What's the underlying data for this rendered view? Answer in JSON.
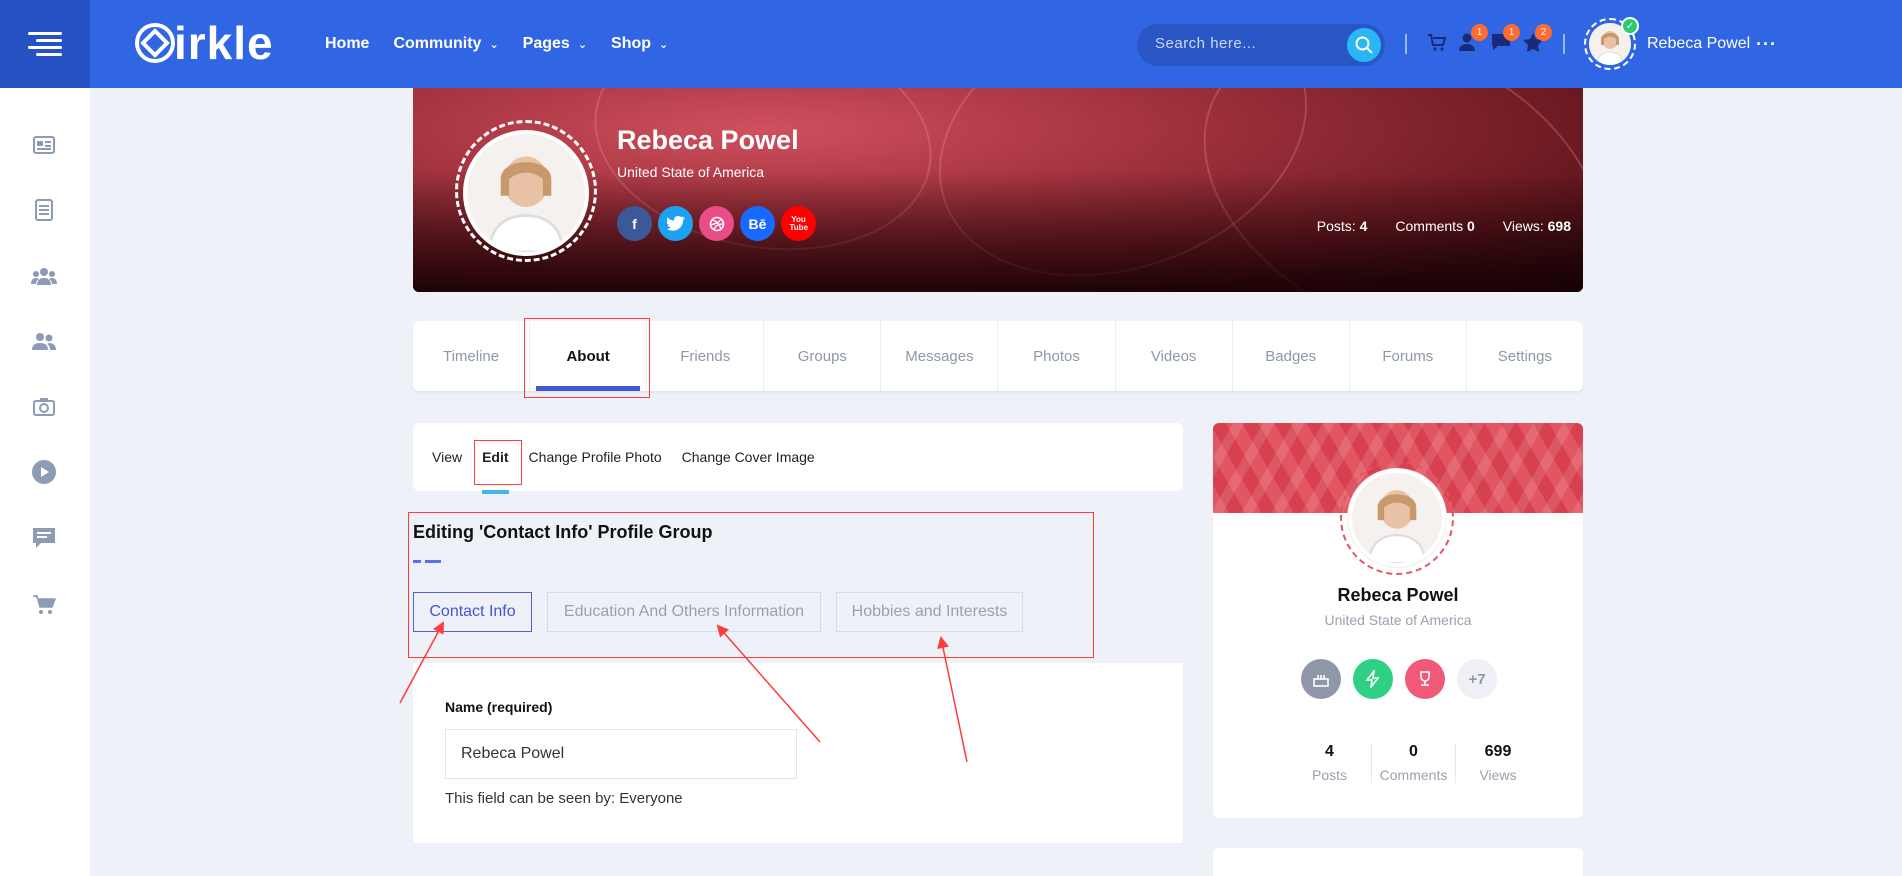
{
  "brand": {
    "logo_text": "irkle"
  },
  "header": {
    "nav": [
      {
        "label": "Home",
        "has_dropdown": false
      },
      {
        "label": "Community",
        "has_dropdown": true
      },
      {
        "label": "Pages",
        "has_dropdown": true
      },
      {
        "label": "Shop",
        "has_dropdown": true
      }
    ],
    "search_placeholder": "Search here...",
    "badges": {
      "friend_requests": "1",
      "messages": "1",
      "notifications": "2"
    },
    "user_name": "Rebeca Powel",
    "more": "···"
  },
  "sidebar": {
    "items": [
      "newsfeed-icon",
      "blog-icon",
      "groups-icon",
      "members-icon",
      "photos-icon",
      "videos-icon",
      "forums-icon",
      "shop-icon"
    ]
  },
  "profile": {
    "name": "Rebeca Powel",
    "location": "United State of America",
    "socials": [
      {
        "label": "f",
        "color": "#3b5998"
      },
      {
        "label": "t",
        "color": "#1da1f2"
      },
      {
        "label": "d",
        "color": "#ea4c89"
      },
      {
        "label": "Bē",
        "color": "#1769ff"
      },
      {
        "label": "You Tube",
        "color": "#ff0000"
      }
    ],
    "stats": {
      "posts_label": "Posts:",
      "posts": "4",
      "comments_label": "Comments",
      "comments": "0",
      "views_label": "Views:",
      "views": "698"
    }
  },
  "tabs": [
    "Timeline",
    "About",
    "Friends",
    "Groups",
    "Messages",
    "Photos",
    "Videos",
    "Badges",
    "Forums",
    "Settings"
  ],
  "active_tab": "About",
  "subnav": {
    "view": "View",
    "edit": "Edit",
    "change_photo": "Change Profile Photo",
    "change_cover": "Change Cover Image"
  },
  "editing": {
    "title": "Editing 'Contact Info' Profile Group",
    "groups": [
      "Contact Info",
      "Education And Others Information",
      "Hobbies and Interests"
    ],
    "active_group": "Contact Info"
  },
  "form": {
    "name_label": "Name (required)",
    "name_value": "Rebeca Powel",
    "visibility_hint": "This field can be seen by: Everyone"
  },
  "widget": {
    "name": "Rebeca Powel",
    "location": "United State of America",
    "more_badges": "+7",
    "stats": [
      {
        "value": "4",
        "label": "Posts"
      },
      {
        "value": "0",
        "label": "Comments"
      },
      {
        "value": "699",
        "label": "Views"
      }
    ]
  },
  "colors": {
    "header": "#3066e3",
    "accent": "#3d5bcf",
    "annotation": "#ff3b3b"
  }
}
